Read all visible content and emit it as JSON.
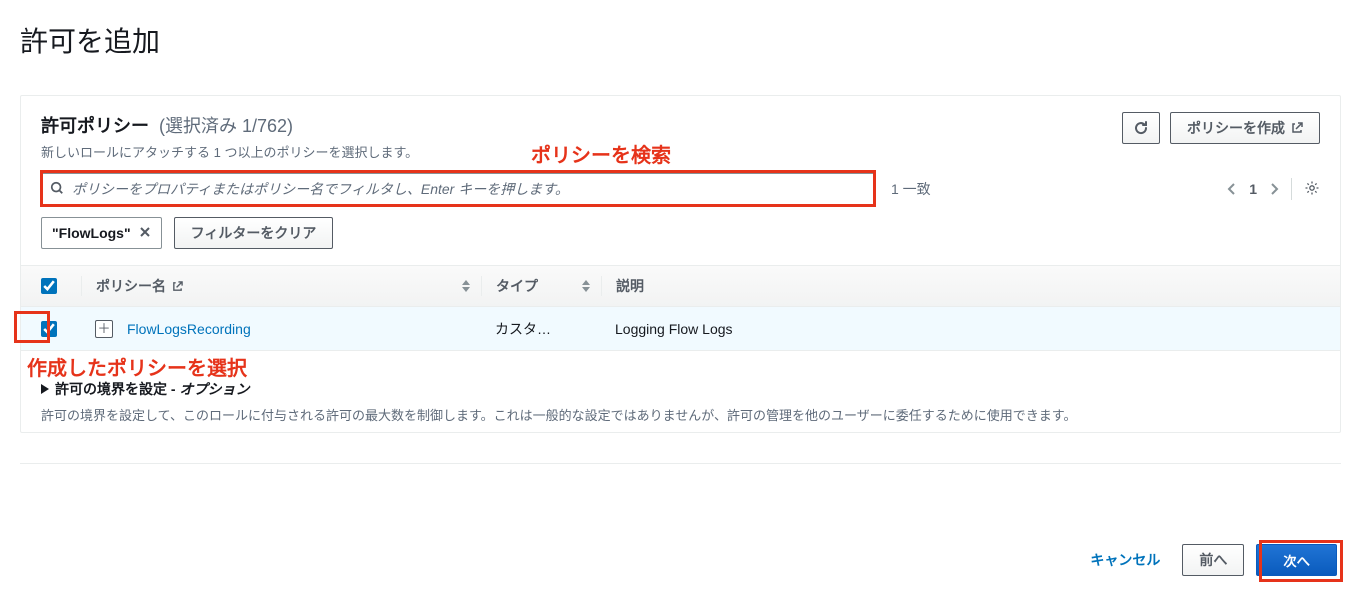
{
  "page": {
    "title": "許可を追加"
  },
  "panel": {
    "title": "許可ポリシー",
    "count": "(選択済み 1/762)",
    "desc": "新しいロールにアタッチする 1 つ以上のポリシーを選択します。",
    "refresh_label": "",
    "create_label": "ポリシーを作成"
  },
  "search": {
    "placeholder": "ポリシーをプロパティまたはポリシー名でフィルタし、Enter キーを押します。",
    "matches": "1 一致"
  },
  "chips": {
    "flowlogs": "\"FlowLogs\"",
    "clear_label": "フィルターをクリア"
  },
  "pager": {
    "page": "1"
  },
  "columns": {
    "name": "ポリシー名",
    "type": "タイプ",
    "desc": "説明"
  },
  "rows": [
    {
      "name": "FlowLogsRecording",
      "type": "カスタ…",
      "desc": "Logging Flow Logs",
      "checked": true
    }
  ],
  "boundary": {
    "title_main": "許可の境界を設定 - ",
    "title_sub": "オプション",
    "desc": "許可の境界を設定して、このロールに付与される許可の最大数を制御します。これは一般的な設定ではありませんが、許可の管理を他のユーザーに委任するために使用できます。"
  },
  "footer": {
    "cancel": "キャンセル",
    "previous": "前へ",
    "next": "次へ"
  },
  "annotations": {
    "search_hint": "ポリシーを検索",
    "select_hint": "作成したポリシーを選択"
  }
}
